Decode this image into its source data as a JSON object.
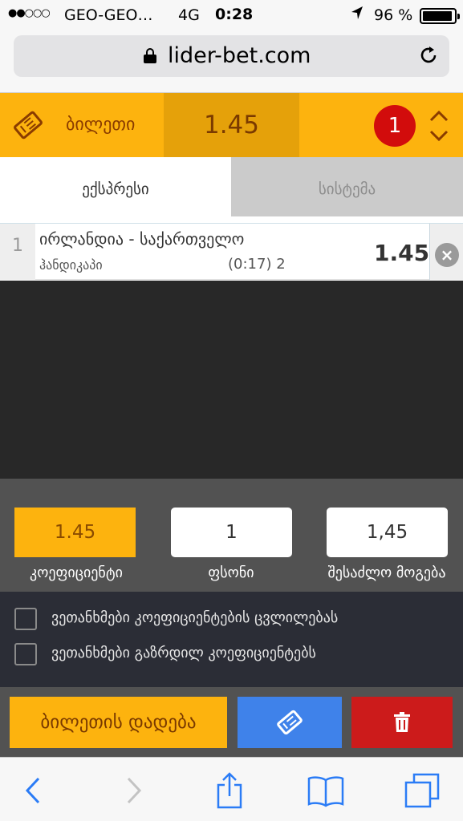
{
  "status_bar": {
    "signal": "●●○○○",
    "carrier": "GEO-GEO…",
    "network": "4G",
    "time": "0:28",
    "battery": "96 %",
    "battery_level": 0.96
  },
  "browser": {
    "url": "lider-bet.com"
  },
  "ticket_header": {
    "label": "ბილეთი",
    "odds": "1.45",
    "count": "1"
  },
  "tabs": [
    {
      "label": "ექსპრესი",
      "active": true
    },
    {
      "label": "სისტემა",
      "active": false
    }
  ],
  "bets": [
    {
      "number": "1",
      "teams": "ირლანდია - საქართველო",
      "market": "ჰანდიკაპი",
      "score": "(0:17) 2",
      "odds": "1.45"
    }
  ],
  "stake": {
    "odds_value": "1.45",
    "odds_label": "კოეფიციენტი",
    "stake_value": "1",
    "stake_label": "ფსონი",
    "win_value": "1,45",
    "win_label": "შესაძლო მოგება"
  },
  "options": [
    {
      "label": "ვეთანხმები კოეფიციენტების ცვლილებას",
      "checked": false
    },
    {
      "label": "ვეთანხმები გაზრდილ კოეფიციენტებს",
      "checked": false
    }
  ],
  "actions": {
    "place_label": "ბილეთის დადება"
  },
  "colors": {
    "accent": "#fdb30e",
    "ticket_button": "#3f82ea",
    "delete_button": "#cc1b1b",
    "badge": "#d20c0c"
  }
}
